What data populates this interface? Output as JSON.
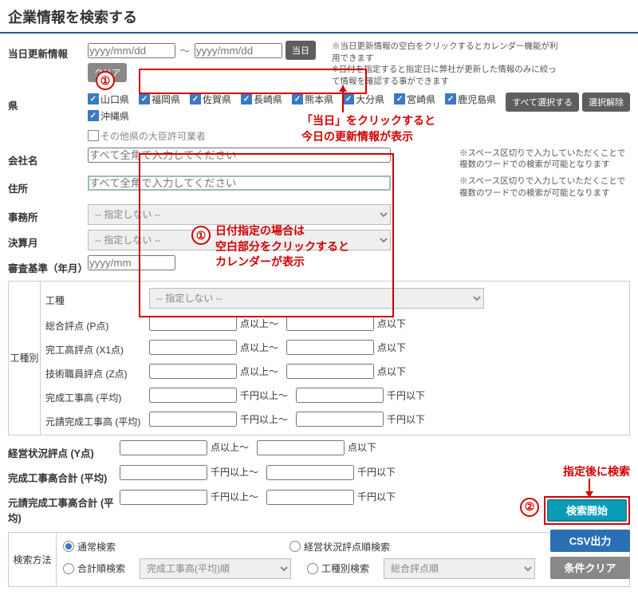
{
  "header": {
    "title": "企業情報を検索する"
  },
  "rows": {
    "update": {
      "label": "当日更新情報",
      "ph": "yyyy/mm/dd",
      "today_btn": "当日",
      "clear_btn": "クリア",
      "note": "※当日更新情報の空白をクリックするとカレンダー機能が利用できます\n※日付を指定すると指定日に弊社が更新した情報のみに絞って情報を確認する事ができます"
    },
    "pref": {
      "label": "県",
      "sel_all": "すべて選択する",
      "unsel": "選択解除",
      "other": "その他県の大臣許可業者",
      "items": [
        "山口県",
        "福岡県",
        "佐賀県",
        "長崎県",
        "熊本県",
        "大分県",
        "宮崎県",
        "鹿児島県",
        "沖縄県"
      ],
      "checked": [
        true,
        true,
        true,
        true,
        true,
        true,
        true,
        true,
        true
      ]
    },
    "company": {
      "label": "会社名",
      "ph": "すべて全角で入力してください",
      "note": "※スペース区切りで入力していただくことで複数のワードでの検索が可能となります"
    },
    "addr": {
      "label": "住所",
      "ph": "すべて全角で入力してください",
      "note": "※スペース区切りで入力していただくことで複数のワードでの検索が可能となります"
    },
    "office": {
      "label": "事務所",
      "ph": "-- 指定しない --"
    },
    "kessan": {
      "label": "決算月",
      "ph": "-- 指定しない --"
    },
    "shinsa": {
      "label": "審査基準（年月）",
      "ph": "yyyy/mm"
    }
  },
  "bytype": {
    "side": "工種別",
    "type": {
      "label": "工種",
      "ph": "-- 指定しない --"
    },
    "p": {
      "label": "総合評点 (P点)",
      "above": "点以上～",
      "below": "点以下"
    },
    "x1": {
      "label": "完工高評点 (X1点)",
      "above": "点以上～",
      "below": "点以下"
    },
    "z": {
      "label": "技術職員評点 (Z点)",
      "above": "点以上～",
      "below": "点以下"
    },
    "avg": {
      "label": "完成工事高 (平均)",
      "above": "千円以上～",
      "below": "千円以下"
    },
    "moto": {
      "label": "元請完成工事高 (平均)",
      "above": "千円以上～",
      "below": "千円以下"
    }
  },
  "below": {
    "y": {
      "label": "経営状況評点 (Y点)",
      "above": "点以上～",
      "below": "点以下"
    },
    "sum": {
      "label": "完成工事高合計 (平均)",
      "above": "千円以上～",
      "below": "千円以下"
    },
    "moto": {
      "label": "元請完成工事高合計 (平均)",
      "above": "千円以上～",
      "below": "千円以下"
    }
  },
  "method": {
    "side": "検索方法",
    "r1": "通常検索",
    "r2": "経営状況評点順検索",
    "r3": "合計順検索",
    "r4": "工種別検索",
    "s1": "完成工事高(平均)順",
    "s2": "総合評点順"
  },
  "btns": {
    "search": "検索開始",
    "csv": "CSV出力",
    "clear": "条件クリア"
  },
  "annot": {
    "n1": "①",
    "n2": "①",
    "n3": "②",
    "t1": "「当日」をクリックすると\n今日の更新情報が表示",
    "t2": "日付指定の場合は\n空白部分をクリックすると\nカレンダーが表示",
    "t3": "指定後に検索"
  }
}
